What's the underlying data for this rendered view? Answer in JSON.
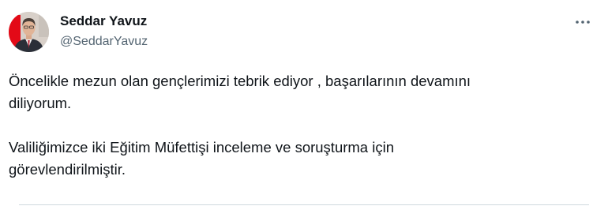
{
  "tweet": {
    "author": {
      "display_name": "Seddar Yavuz",
      "handle": "@SeddarYavuz",
      "avatar_icon": "avatar-portrait"
    },
    "more_icon": "more-horizontal-icon",
    "text_lines": [
      "Öncelikle mezun olan gençlerimizi tebrik ediyor , başarılarının devamını",
      "diliyorum.",
      "Valiliğimizce iki Eğitim Müfettişi inceleme ve soruşturma için",
      "görevlendirilmiştir."
    ]
  },
  "colors": {
    "text_primary": "#0f1419",
    "text_secondary": "#536471",
    "divider": "#cfd9de",
    "flag_red": "#e30a17"
  }
}
